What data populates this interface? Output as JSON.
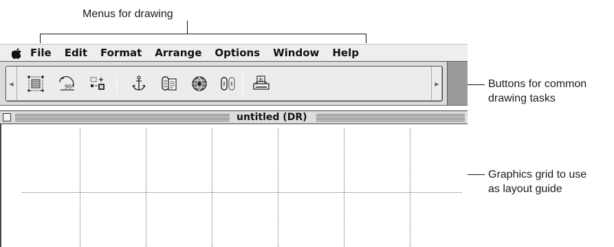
{
  "callouts": {
    "menus": "Menus for drawing",
    "buttons": [
      "Buttons for common",
      "drawing tasks"
    ],
    "grid": [
      "Graphics grid to use",
      "as layout guide"
    ]
  },
  "menubar": {
    "apple_icon": "apple-icon",
    "items": [
      "File",
      "Edit",
      "Format",
      "Arrange",
      "Options",
      "Window",
      "Help"
    ]
  },
  "toolbar": {
    "rotate_label": "90°",
    "tools": [
      "group-select-icon",
      "rotate-90-icon",
      "align-objects-icon",
      "anchor-icon",
      "frame-link-icon",
      "pattern-fill-icon",
      "link-icon",
      "print-icon"
    ]
  },
  "window": {
    "title": "untitled (DR)"
  },
  "colors": {
    "menubar_bg": "#eeeeee",
    "toolbar_bg": "#ececec",
    "toolbar_right_panel": "#9a9a9a",
    "titlebar_bg": "#dddddd",
    "grid_dots": "#666666"
  }
}
